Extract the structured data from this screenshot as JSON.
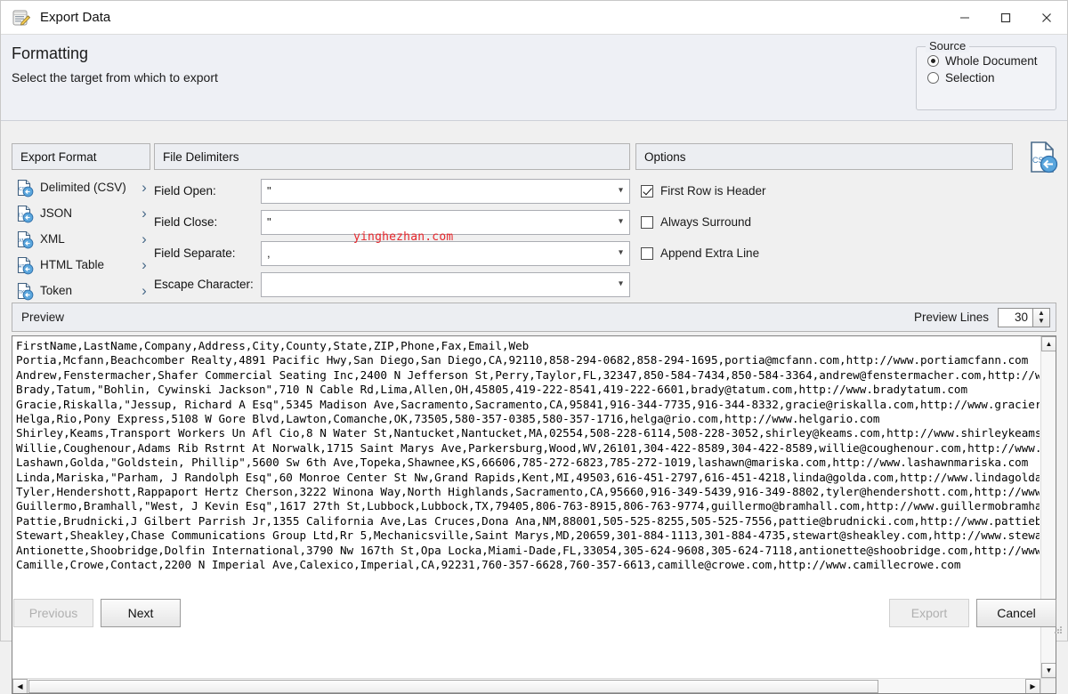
{
  "window": {
    "title": "Export Data",
    "icon": "export-data-icon",
    "minimize_label": "—",
    "maximize_label": "☐",
    "close_label": "✕"
  },
  "header": {
    "title": "Formatting",
    "subtitle": "Select the target from which to export"
  },
  "source": {
    "legend": "Source",
    "options": [
      {
        "label": "Whole Document",
        "checked": true
      },
      {
        "label": "Selection",
        "checked": false
      }
    ]
  },
  "export_format": {
    "group_title": "Export Format",
    "items": [
      {
        "label": "Delimited (CSV)",
        "icon": "csv-file-icon",
        "chevron": "›"
      },
      {
        "label": "JSON",
        "icon": "json-file-icon",
        "chevron": "›"
      },
      {
        "label": "XML",
        "icon": "xml-file-icon",
        "chevron": "›"
      },
      {
        "label": "HTML Table",
        "icon": "html-file-icon",
        "chevron": "›"
      },
      {
        "label": "Token",
        "icon": "token-file-icon",
        "chevron": "›"
      }
    ]
  },
  "file_delimiters": {
    "group_title": "File Delimiters",
    "fields": [
      {
        "label": "Field Open:",
        "value": "\""
      },
      {
        "label": "Field Close:",
        "value": "\""
      },
      {
        "label": "Field Separate:",
        "value": ","
      },
      {
        "label": "Escape Character:",
        "value": ""
      }
    ]
  },
  "options": {
    "group_title": "Options",
    "items": [
      {
        "label": "First Row is Header",
        "checked": true
      },
      {
        "label": "Always Surround",
        "checked": false
      },
      {
        "label": "Append Extra Line",
        "checked": false
      }
    ]
  },
  "format_badge": {
    "icon": "csv-import-icon",
    "label": "CSV"
  },
  "preview": {
    "group_title": "Preview",
    "lines_label": "Preview Lines",
    "lines_value": "30",
    "spinner_up": "▲",
    "spinner_down": "▼",
    "text": "FirstName,LastName,Company,Address,City,County,State,ZIP,Phone,Fax,Email,Web\nPortia,Mcfann,Beachcomber Realty,4891 Pacific Hwy,San Diego,San Diego,CA,92110,858-294-0682,858-294-1695,portia@mcfann.com,http://www.portiamcfann.com\nAndrew,Fenstermacher,Shafer Commercial Seating Inc,2400 N Jefferson St,Perry,Taylor,FL,32347,850-584-7434,850-584-3364,andrew@fenstermacher.com,http://www.andrewfenstermacher.com\nBrady,Tatum,\"Bohlin, Cywinski Jackson\",710 N Cable Rd,Lima,Allen,OH,45805,419-222-8541,419-222-6601,brady@tatum.com,http://www.bradytatum.com\nGracie,Riskalla,\"Jessup, Richard A Esq\",5345 Madison Ave,Sacramento,Sacramento,CA,95841,916-344-7735,916-344-8332,gracie@riskalla.com,http://www.gracieriskalla.com\nHelga,Rio,Pony Express,5108 W Gore Blvd,Lawton,Comanche,OK,73505,580-357-0385,580-357-1716,helga@rio.com,http://www.helgario.com\nShirley,Keams,Transport Workers Un Afl Cio,8 N Water St,Nantucket,Nantucket,MA,02554,508-228-6114,508-228-3052,shirley@keams.com,http://www.shirleykeams.com\nWillie,Coughenour,Adams Rib Rstrnt At Norwalk,1715 Saint Marys Ave,Parkersburg,Wood,WV,26101,304-422-8589,304-422-8589,willie@coughenour.com,http://www.williecoughenour.com\nLashawn,Golda,\"Goldstein, Phillip\",5600 Sw 6th Ave,Topeka,Shawnee,KS,66606,785-272-6823,785-272-1019,lashawn@mariska.com,http://www.lashawnmariska.com\nLinda,Mariska,\"Parham, J Randolph Esq\",60 Monroe Center St Nw,Grand Rapids,Kent,MI,49503,616-451-2797,616-451-4218,linda@golda.com,http://www.lindagolda.com\nTyler,Hendershott,Rappaport Hertz Cherson,3222 Winona Way,North Highlands,Sacramento,CA,95660,916-349-5439,916-349-8802,tyler@hendershott.com,http://www.tylerhendershott.com\nGuillermo,Bramhall,\"West, J Kevin Esq\",1617 27th St,Lubbock,Lubbock,TX,79405,806-763-8915,806-763-9774,guillermo@bramhall.com,http://www.guillermobramhall.com\nPattie,Brudnicki,J Gilbert Parrish Jr,1355 California Ave,Las Cruces,Dona Ana,NM,88001,505-525-8255,505-525-7556,pattie@brudnicki.com,http://www.pattiebrudnicki.com\nStewart,Sheakley,Chase Communications Group Ltd,Rr 5,Mechanicsville,Saint Marys,MD,20659,301-884-1113,301-884-4735,stewart@sheakley.com,http://www.stewartsheakley.com\nAntionette,Shoobridge,Dolfin International,3790 Nw 167th St,Opa Locka,Miami-Dade,FL,33054,305-624-9608,305-624-7118,antionette@shoobridge.com,http://www.antionetteshoobridge.com\nCamille,Crowe,Contact,2200 N Imperial Ave,Calexico,Imperial,CA,92231,760-357-6628,760-357-6613,camille@crowe.com,http://www.camillecrowe.com"
  },
  "watermark": "yinghezhan.com",
  "footer": {
    "previous_label": "Previous",
    "next_label": "Next",
    "export_label": "Export",
    "cancel_label": "Cancel"
  }
}
